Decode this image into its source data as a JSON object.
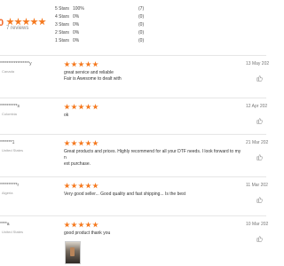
{
  "summary": {
    "score": "0",
    "reviews_label": "7 reviews",
    "distribution": [
      {
        "label": "5 Stars",
        "percent": "100%",
        "count": "(7)"
      },
      {
        "label": "4 Stars",
        "percent": "0%",
        "count": "(0)"
      },
      {
        "label": "3 Stars",
        "percent": "0%",
        "count": "(0)"
      },
      {
        "label": "2 Stars",
        "percent": "0%",
        "count": "(0)"
      },
      {
        "label": "1 Stars",
        "percent": "0%",
        "count": "(0)"
      }
    ]
  },
  "reviews": [
    {
      "name": "*****************y",
      "country": "Canada",
      "rating": 5,
      "date": "13 May 202",
      "text": "great service and reliable\nFair is Awesome to dealt with"
    },
    {
      "name": "**********s",
      "country": "Colombia",
      "rating": 5,
      "date": "12 Apr 202",
      "text": "ok"
    },
    {
      "name": "*******1",
      "country": "United States",
      "rating": 5,
      "date": "21 Mar 202",
      "text": "Great products and prices. Highly recommend for all your DTF needs. I look forward to my n\next purchase."
    },
    {
      "name": "**********r",
      "country": "Algeria",
      "rating": 5,
      "date": "11 Mar 202",
      "text": "Very good seller... Good quality and fast shipping... Is the best"
    },
    {
      "name": "****a",
      "country": "United States",
      "rating": 5,
      "date": "10 Mar 202",
      "text": "good product thank you"
    }
  ],
  "colors": {
    "star": "#f5791f",
    "accent": "#f26522"
  },
  "icons": {
    "like": "thumbs-up-icon",
    "star": "star-icon"
  }
}
